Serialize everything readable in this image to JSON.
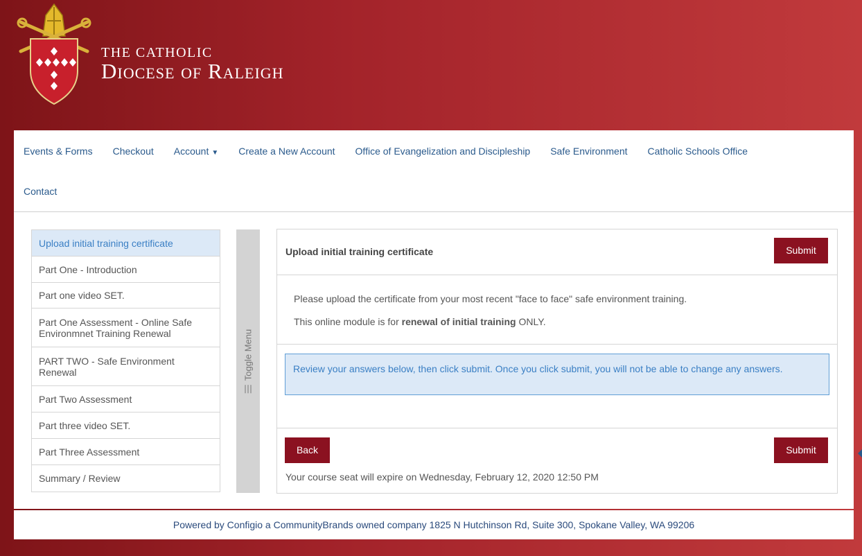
{
  "header": {
    "brand_small": "THE CATHOLIC",
    "brand_large": "Diocese of Raleigh"
  },
  "nav": {
    "items": [
      "Events & Forms",
      "Checkout",
      "Account",
      "Create a New Account",
      "Office of Evangelization and Discipleship",
      "Safe Environment",
      "Catholic Schools Office",
      "Contact"
    ]
  },
  "sidebar": {
    "items": [
      "Upload initial training certificate",
      "Part One - Introduction",
      "Part one video SET.",
      "Part One Assessment - Online Safe Environmnet Training Renewal",
      "PART TWO - Safe Environment Renewal",
      "Part Two Assessment",
      "Part three video SET.",
      "Part Three Assessment",
      "Summary / Review"
    ],
    "toggle_label": "Toggle Menu"
  },
  "panel": {
    "title": "Upload initial training certificate",
    "submit_label": "Submit",
    "line1": "Please upload the certificate from your most recent \"face to face\" safe environment training.",
    "line2_pre": "This online module is for ",
    "line2_bold": "renewal of initial training",
    "line2_post": " ONLY.",
    "info": "Review your answers below, then click submit. Once you click submit, you will not be able to change any answers.",
    "back_label": "Back",
    "expire": "Your course seat will expire on Wednesday, February 12, 2020 12:50 PM"
  },
  "footer": {
    "text": "Powered by Configio a CommunityBrands owned company 1825 N Hutchinson Rd, Suite 300, Spokane Valley, WA 99206"
  }
}
